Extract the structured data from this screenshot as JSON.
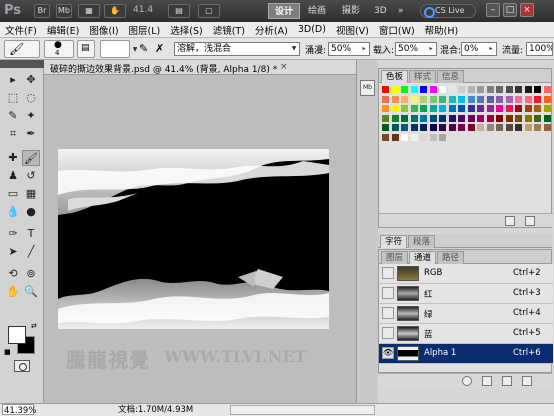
{
  "titlebar": {
    "logo": "Ps",
    "br": "Br",
    "mb": "Mb",
    "zoom": "41.4",
    "workspaces": [
      "设计",
      "绘画",
      "摄影",
      "3D",
      "»"
    ],
    "active_workspace": "设计",
    "cs_live": "CS Live",
    "win_min": "–",
    "win_max": "□",
    "win_close": "×"
  },
  "menubar": {
    "items": [
      "文件(F)",
      "编辑(E)",
      "图像(I)",
      "图层(L)",
      "选择(S)",
      "滤镜(T)",
      "分析(A)",
      "3D(D)",
      "视图(V)",
      "窗口(W)",
      "帮助(H)"
    ]
  },
  "options": {
    "brush_size": "4",
    "mode_value": "溶解，浅混合",
    "opacity_label": "涌漫:",
    "opacity_value": "50%",
    "flow_label": "载入:",
    "flow_value": "50%",
    "mix_label": "混合:",
    "mix_value": "0%",
    "rate_label": "流量:",
    "rate_value": "100%"
  },
  "document": {
    "tab_title": "破碎的撕边效果背景.psd @ 41.4% (背景, Alpha 1/8) *",
    "close": "×",
    "watermark_cn": "騰龍視覺",
    "watermark_url": "WWW.TLVI.NET"
  },
  "status": {
    "zoom": "41.39%",
    "doc": "文档:1.70M/4.93M"
  },
  "swatches_panel": {
    "tabs": [
      "色板",
      "样式",
      "信息"
    ],
    "active_tab": "色板",
    "colors": [
      "#ff0000",
      "#ffff00",
      "#00ff00",
      "#00ffff",
      "#0000ff",
      "#ff00ff",
      "#ffffff",
      "#e6e6e6",
      "#cccccc",
      "#b3b3b3",
      "#999999",
      "#808080",
      "#666666",
      "#4d4d4d",
      "#333333",
      "#1a1a1a",
      "#000000",
      "#ff6666",
      "#f26c4f",
      "#f68e55",
      "#fbaf5c",
      "#fff467",
      "#acd372",
      "#7cc576",
      "#3bb878",
      "#1abbb4",
      "#00bff3",
      "#438cca",
      "#5574b9",
      "#605ca8",
      "#855fa8",
      "#a763a8",
      "#f06ea9",
      "#f26d7d",
      "#ed1c24",
      "#f26522",
      "#f7941d",
      "#fff200",
      "#8dc63f",
      "#39b54a",
      "#00a651",
      "#00a99d",
      "#00aeef",
      "#0072bc",
      "#0054a6",
      "#2e3192",
      "#662d91",
      "#92278f",
      "#ec008c",
      "#ed145b",
      "#9e0b0f",
      "#a0410d",
      "#a36209",
      "#aba000",
      "#598527",
      "#197b30",
      "#007236",
      "#00746b",
      "#0076a3",
      "#004a80",
      "#003471",
      "#1b1464",
      "#440e62",
      "#630460",
      "#9e005d",
      "#9e0039",
      "#790000",
      "#7b2e00",
      "#7d4900",
      "#827b00",
      "#406618",
      "#005e20",
      "#005826",
      "#005952",
      "#005b7f",
      "#003663",
      "#002157",
      "#0d004c",
      "#32004b",
      "#4b0049",
      "#7b0046",
      "#7a0026",
      "#c7b299",
      "#998675",
      "#736357",
      "#534741",
      "#37302d",
      "#c69c6d",
      "#a67c52",
      "#8c6239",
      "#754c24",
      "#603913",
      "#ffffff",
      "#f2f2f2",
      "#d9d9d9",
      "#bfbfbf",
      "#a6a6a6"
    ]
  },
  "char_panel": {
    "tabs": [
      "字符",
      "段落"
    ],
    "active_tab": "字符"
  },
  "channels_panel": {
    "tabs": [
      "图层",
      "通道",
      "路径"
    ],
    "active_tab": "通道",
    "rows": [
      {
        "name": "RGB",
        "key": "Ctrl+2",
        "selected": false,
        "eye": ""
      },
      {
        "name": "红",
        "key": "Ctrl+3",
        "selected": false,
        "eye": ""
      },
      {
        "name": "绿",
        "key": "Ctrl+4",
        "selected": false,
        "eye": ""
      },
      {
        "name": "蓝",
        "key": "Ctrl+5",
        "selected": false,
        "eye": ""
      },
      {
        "name": "Alpha 1",
        "key": "Ctrl+6",
        "selected": true,
        "eye": "👁"
      }
    ]
  },
  "colors": {
    "accent_selection": "#0b2c6e",
    "title_bg": "#3a3a3a",
    "canvas": "#000000"
  }
}
